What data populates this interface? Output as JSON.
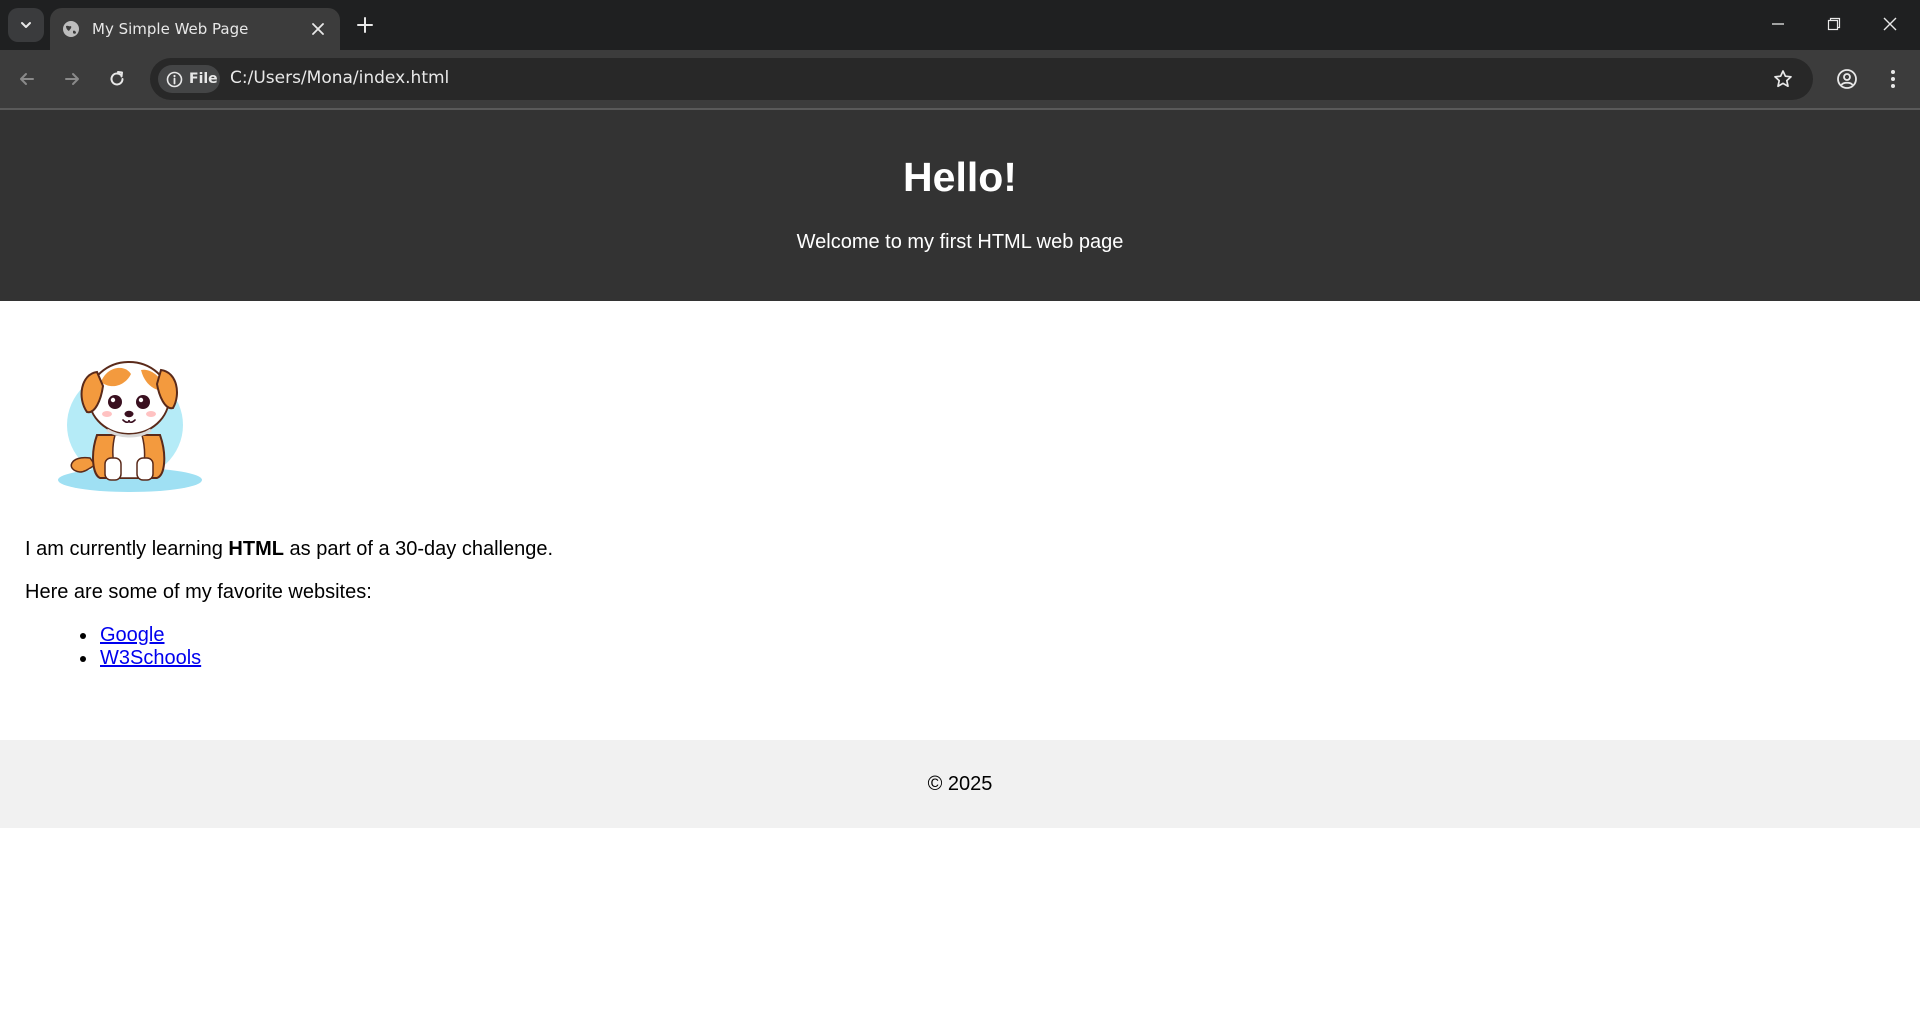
{
  "browser": {
    "tab": {
      "title": "My Simple Web Page"
    },
    "address": {
      "chip_label": "File",
      "url": "C:/Users/Mona/index.html"
    }
  },
  "page": {
    "header": {
      "title": "Hello!",
      "subtitle": "Welcome to my first HTML web page"
    },
    "image": {
      "alt": "cartoon puppy"
    },
    "intro": {
      "before": "I am currently learning ",
      "bold": "HTML",
      "after": " as part of a 30-day challenge."
    },
    "favorites_intro": "Here are some of my favorite websites:",
    "links": [
      {
        "label": "Google"
      },
      {
        "label": "W3Schools"
      }
    ],
    "footer": {
      "text": "© 2025"
    }
  },
  "colors": {
    "tabbar_bg": "#1f2021",
    "toolbar_bg": "#3c3c3c",
    "header_bg": "#333333",
    "footer_bg": "#f1f1f1",
    "link": "#0000ee",
    "dog_orange": "#f39a3e",
    "dog_bg_blue": "#a6e4f4"
  }
}
